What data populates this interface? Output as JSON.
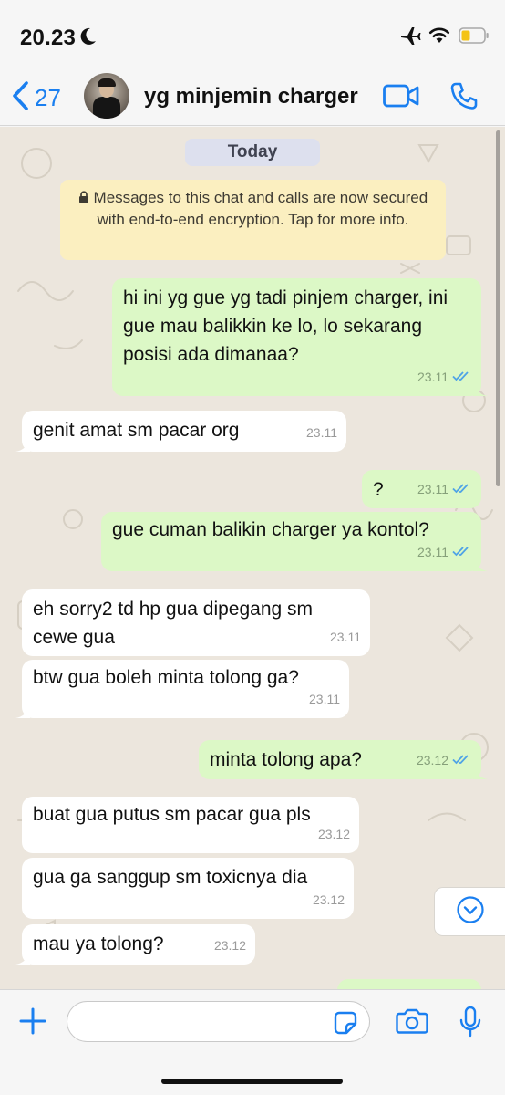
{
  "status_bar": {
    "time": "20.23"
  },
  "header": {
    "back_count": "27",
    "contact_name": "yg minjemin charger"
  },
  "chat": {
    "date_chip": "Today",
    "encryption_notice": "Messages to this chat and calls are now secured with end-to-end encryption. Tap for more info.",
    "messages": [
      {
        "dir": "out",
        "text": "hi ini yg gue yg tadi pinjem charger, ini gue mau balikkin ke lo, lo sekarang posisi ada dimanaa?",
        "time": "23.11"
      },
      {
        "dir": "in",
        "text": "genit amat sm pacar org",
        "time": "23.11"
      },
      {
        "dir": "out",
        "text": "?",
        "time": "23.11"
      },
      {
        "dir": "out",
        "text": "gue cuman balikin charger ya kontol?",
        "time": "23.11"
      },
      {
        "dir": "in",
        "text": "eh sorry2 td hp gua dipegang sm cewe gua",
        "time": "23.11"
      },
      {
        "dir": "in",
        "text": "btw gua boleh minta tolong ga?",
        "time": "23.11"
      },
      {
        "dir": "out",
        "text": "minta tolong apa?",
        "time": "23.12"
      },
      {
        "dir": "in",
        "text": "buat gua putus sm pacar gua pls",
        "time": "23.12"
      },
      {
        "dir": "in",
        "text": "gua ga sanggup sm toxicnya dia",
        "time": "23.12"
      },
      {
        "dir": "in",
        "text": "mau ya tolong?",
        "time": "23.12"
      }
    ]
  },
  "input": {
    "value": "",
    "placeholder": ""
  },
  "colors": {
    "accent": "#1a7ff0",
    "outgoing": "#dcf8c6",
    "incoming": "#ffffff",
    "read_tick": "#4fa3e6",
    "notice": "#fbefc0",
    "chat_bg": "#ece6dd"
  },
  "icons": [
    "moon-icon",
    "airplane-icon",
    "wifi-icon",
    "battery-icon",
    "back-chevron-icon",
    "video-call-icon",
    "phone-call-icon",
    "lock-icon",
    "double-tick-icon",
    "chevron-down-icon",
    "plus-icon",
    "sticker-icon",
    "camera-icon",
    "microphone-icon"
  ]
}
